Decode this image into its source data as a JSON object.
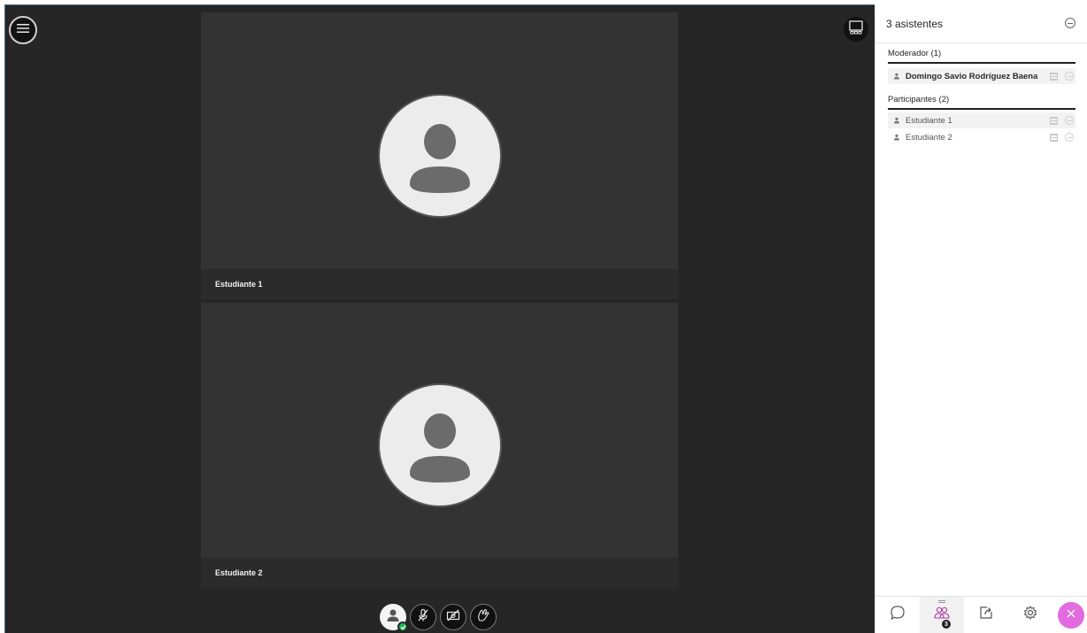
{
  "session": {
    "participant_tiles": [
      {
        "name": "Estudiante 1"
      },
      {
        "name": "Estudiante 2"
      }
    ]
  },
  "attendees_panel": {
    "title": "3 asistentes",
    "moderators": {
      "heading": "Moderador (1)",
      "people": [
        "Domingo Savio Rodríguez Baena"
      ]
    },
    "participants": {
      "heading": "Participantes (2)",
      "people": [
        "Estudiante 1",
        "Estudiante 2"
      ]
    },
    "tabs": {
      "attendees_badge": "3"
    }
  },
  "icons": {
    "menu": "hamburger-icon",
    "layout": "layout-toggle-icon",
    "avatar": "user-avatar-icon",
    "mic": "microphone-muted-icon",
    "camera": "camera-off-icon",
    "hand": "raise-hand-icon",
    "chat": "chat-icon",
    "attendees": "attendees-icon",
    "share": "share-content-icon",
    "settings": "settings-icon",
    "leave": "close-icon"
  },
  "colors": {
    "stage_bg": "#262626",
    "tile_bg": "#333333",
    "status_ok": "#1db954",
    "leave_button": "#e36ae0"
  }
}
